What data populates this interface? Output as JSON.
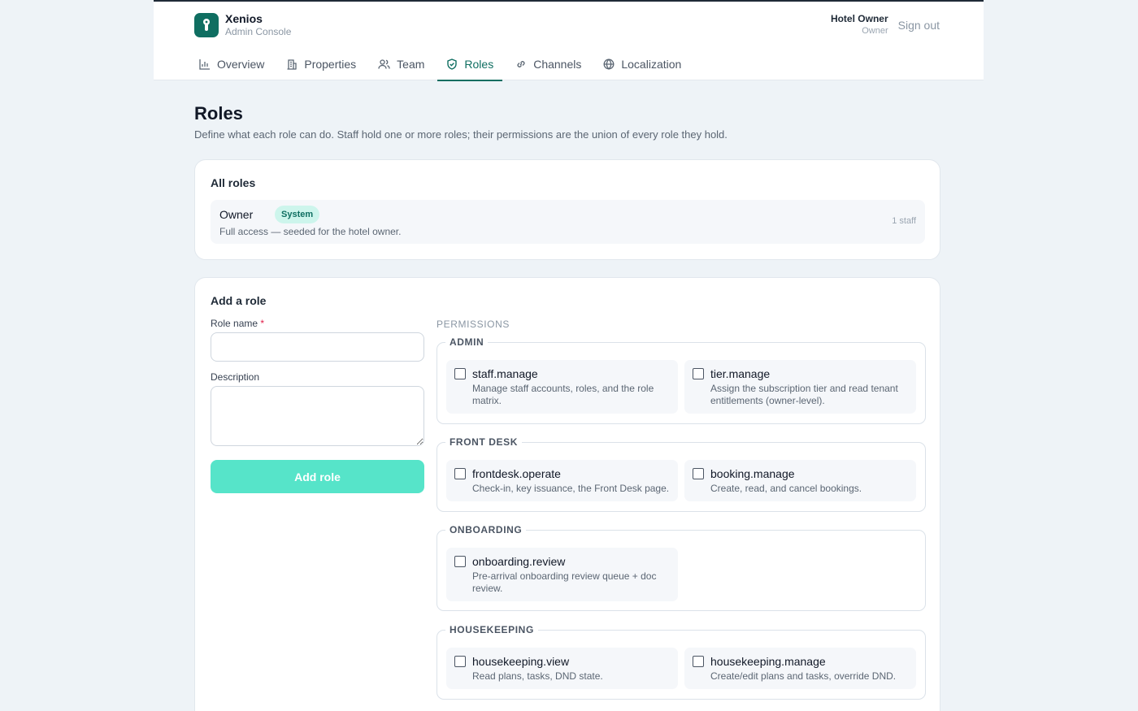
{
  "app": {
    "name": "Xenios",
    "subtitle": "Admin Console"
  },
  "user": {
    "name": "Hotel Owner",
    "role": "Owner",
    "signout_label": "Sign out"
  },
  "nav": {
    "tabs": [
      {
        "label": "Overview",
        "icon": "bar-chart-icon"
      },
      {
        "label": "Properties",
        "icon": "building-icon"
      },
      {
        "label": "Team",
        "icon": "users-icon"
      },
      {
        "label": "Roles",
        "icon": "shield-icon",
        "active": true
      },
      {
        "label": "Channels",
        "icon": "link-icon"
      },
      {
        "label": "Localization",
        "icon": "globe-icon"
      }
    ]
  },
  "page": {
    "title": "Roles",
    "subtitle": "Define what each role can do. Staff hold one or more roles; their permissions are the union of every role they hold."
  },
  "roles_card": {
    "title": "All roles",
    "roles": [
      {
        "name": "Owner",
        "badge": "System",
        "description": "Full access — seeded for the hotel owner.",
        "count": "1 staff"
      }
    ]
  },
  "add_card": {
    "title": "Add a role",
    "role_name_label": "Role name",
    "required_mark": "*",
    "role_name_value": "",
    "description_label": "Description",
    "description_value": "",
    "submit_label": "Add role",
    "permissions_heading": "PERMISSIONS",
    "groups": [
      {
        "name": "ADMIN",
        "permissions": [
          {
            "name": "staff.manage",
            "description": "Manage staff accounts, roles, and the role matrix.",
            "checked": false
          },
          {
            "name": "tier.manage",
            "description": "Assign the subscription tier and read tenant entitlements (owner-level).",
            "checked": false
          }
        ]
      },
      {
        "name": "FRONT DESK",
        "permissions": [
          {
            "name": "frontdesk.operate",
            "description": "Check-in, key issuance, the Front Desk page.",
            "checked": false
          },
          {
            "name": "booking.manage",
            "description": "Create, read, and cancel bookings.",
            "checked": false
          }
        ]
      },
      {
        "name": "ONBOARDING",
        "permissions": [
          {
            "name": "onboarding.review",
            "description": "Pre-arrival onboarding review queue + doc review.",
            "checked": false
          }
        ]
      },
      {
        "name": "HOUSEKEEPING",
        "permissions": [
          {
            "name": "housekeeping.view",
            "description": "Read plans, tasks, DND state.",
            "checked": false
          },
          {
            "name": "housekeeping.manage",
            "description": "Create/edit plans and tasks, override DND.",
            "checked": false
          }
        ]
      }
    ]
  },
  "colors": {
    "accent": "#0f6e61",
    "button": "#56e4c9",
    "badge_bg": "#cdf5ec"
  }
}
